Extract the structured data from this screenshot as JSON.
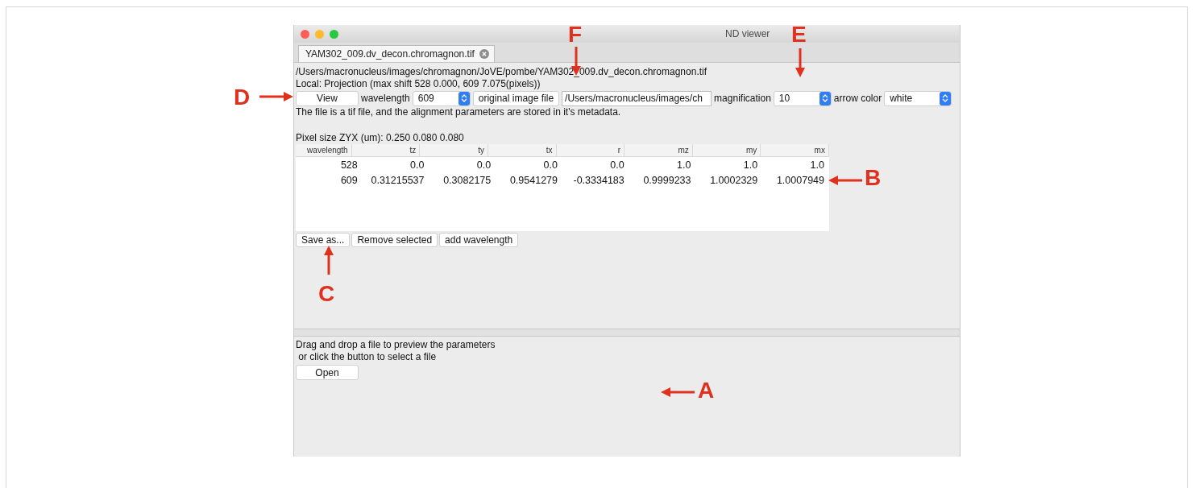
{
  "window": {
    "title": "ND viewer"
  },
  "tabs": [
    {
      "label": "YAM302_009.dv_decon.chromagnon.tif",
      "selected": true
    }
  ],
  "file_path": "/Users/macronucleus/images/chromagnon/JoVE/pombe/YAM302_009.dv_decon.chromagnon.tif",
  "local_info": "Local:  Projection (max shift 528 0.000, 609 7.075(pixels))",
  "toolbar": {
    "view_button": "View",
    "wavelength_label": "wavelength",
    "wavelength_value": "609",
    "original_button": "original image file",
    "path_field": "/Users/macronucleus/images/ch",
    "magnification_label": "magnification",
    "magnification_value": "10",
    "arrow_color_label": "arrow color",
    "arrow_color_value": "white"
  },
  "message": "The file is a tif file, and the alignment parameters are stored in it's metadata.",
  "pixel_size": "Pixel size ZYX (um): 0.250  0.080  0.080",
  "table": {
    "columns": [
      "wavelength",
      "tz",
      "ty",
      "tx",
      "r",
      "mz",
      "my",
      "mx"
    ],
    "rows": [
      [
        "528",
        "0.0",
        "0.0",
        "0.0",
        "0.0",
        "1.0",
        "1.0",
        "1.0"
      ],
      [
        "609",
        "0.31215537",
        "0.3082175",
        "0.9541279",
        "-0.3334183",
        "0.9999233",
        "1.0002329",
        "1.0007949"
      ]
    ]
  },
  "table_buttons": [
    "Save as...",
    "Remove selected",
    "add wavelength"
  ],
  "drop_panel": {
    "lines": [
      "Drag and drop a file to preview the parameters",
      " or click the button to select a file"
    ],
    "button": "Open"
  },
  "annotations": [
    {
      "label": "D",
      "kind": "right"
    },
    {
      "label": "F",
      "kind": "down"
    },
    {
      "label": "E",
      "kind": "down"
    },
    {
      "label": "B",
      "kind": "left"
    },
    {
      "label": "C",
      "kind": "up"
    },
    {
      "label": "A",
      "kind": "left"
    }
  ]
}
